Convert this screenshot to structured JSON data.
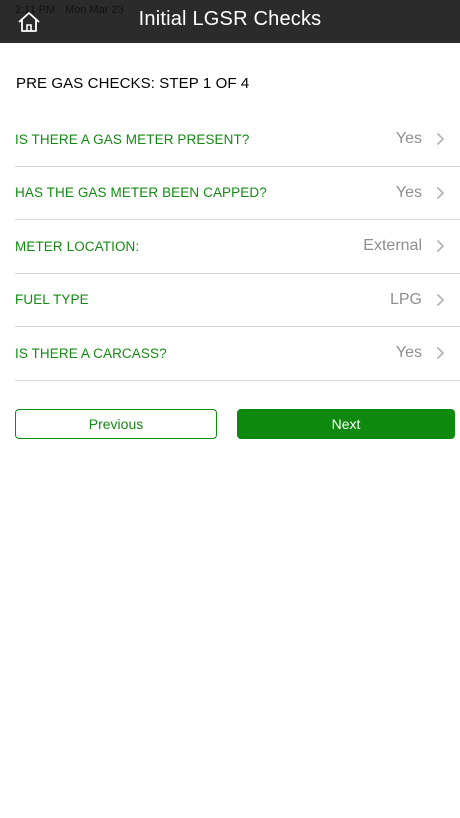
{
  "status_bar": {
    "time": "2:11 PM",
    "date": "Mon Mar 23"
  },
  "header": {
    "title": "Initial LGSR Checks",
    "home_icon": "home-icon"
  },
  "step_title": "PRE GAS CHECKS: STEP 1 OF 4",
  "rows": [
    {
      "label": "IS THERE A GAS METER PRESENT?",
      "value": "Yes"
    },
    {
      "label": "HAS THE GAS METER BEEN CAPPED?",
      "value": "Yes"
    },
    {
      "label": "METER LOCATION:",
      "value": "External"
    },
    {
      "label": "FUEL TYPE",
      "value": "LPG"
    },
    {
      "label": "IS THERE A CARCASS?",
      "value": "Yes"
    }
  ],
  "buttons": {
    "previous": "Previous",
    "next": "Next"
  },
  "colors": {
    "header_bg": "#2b2b2b",
    "accent_green": "#138a13",
    "next_button_bg": "#0d8a0d",
    "value_gray": "#8e8e8e",
    "divider": "#d6d6d6"
  }
}
